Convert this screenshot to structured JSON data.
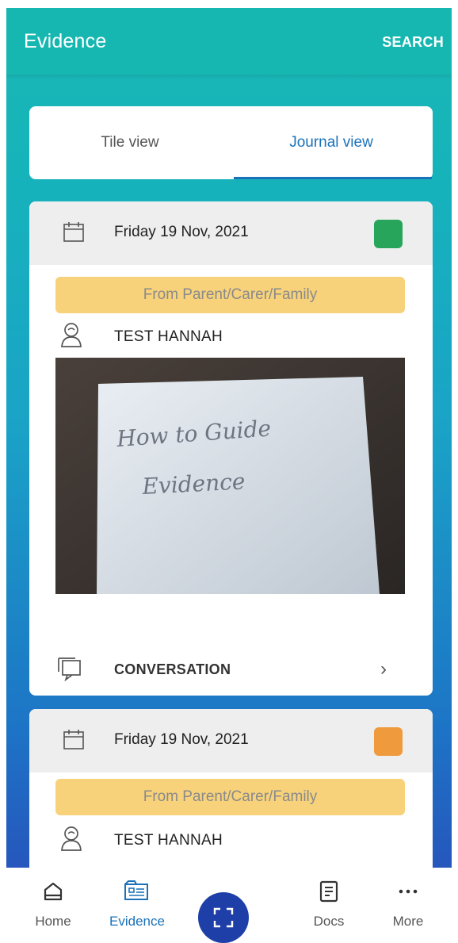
{
  "appbar": {
    "title": "Evidence",
    "search_label": "SEARCH"
  },
  "tabs": [
    {
      "label": "Tile view",
      "active": false
    },
    {
      "label": "Journal view",
      "active": true
    }
  ],
  "cards": [
    {
      "date": "Friday 19 Nov, 2021",
      "status_color": "#27a55a",
      "source": "From Parent/Carer/Family",
      "person": "TEST HANNAH",
      "photo": {
        "handwriting": [
          "How to Guide",
          "Evidence"
        ]
      },
      "conversation_label": "CONVERSATION"
    },
    {
      "date": "Friday 19 Nov, 2021",
      "status_color": "#f09a3e",
      "source": "From Parent/Carer/Family",
      "person": "TEST HANNAH"
    }
  ],
  "bottom_nav": [
    {
      "label": "Home",
      "icon": "home-icon",
      "active": false
    },
    {
      "label": "Evidence",
      "icon": "evidence-icon",
      "active": true
    },
    {
      "label": "",
      "icon": "scan-icon",
      "active": false
    },
    {
      "label": "Docs",
      "icon": "docs-icon",
      "active": false
    },
    {
      "label": "More",
      "icon": "more-icon",
      "active": false
    }
  ],
  "colors": {
    "accent": "#1b72b9",
    "appbar": "#17b7b1",
    "source_badge": "#f7d27a",
    "fab": "#1f3fa8"
  }
}
